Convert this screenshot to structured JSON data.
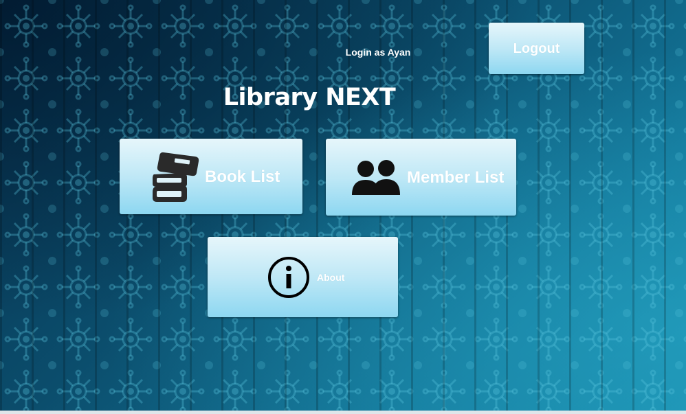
{
  "header": {
    "login_text": "Login as Ayan",
    "logout_label": "Logout"
  },
  "app": {
    "title": "Library NEXT"
  },
  "menu": {
    "book_list": {
      "label": "Book List",
      "icon": "books-icon"
    },
    "member_list": {
      "label": "Member List",
      "icon": "users-icon"
    },
    "about": {
      "label": "About",
      "icon": "info-icon"
    }
  },
  "colors": {
    "background": "#0d4f6e",
    "button_top": "#e6f6fb",
    "button_bottom": "#8dd7f1",
    "text": "#ffffff"
  }
}
